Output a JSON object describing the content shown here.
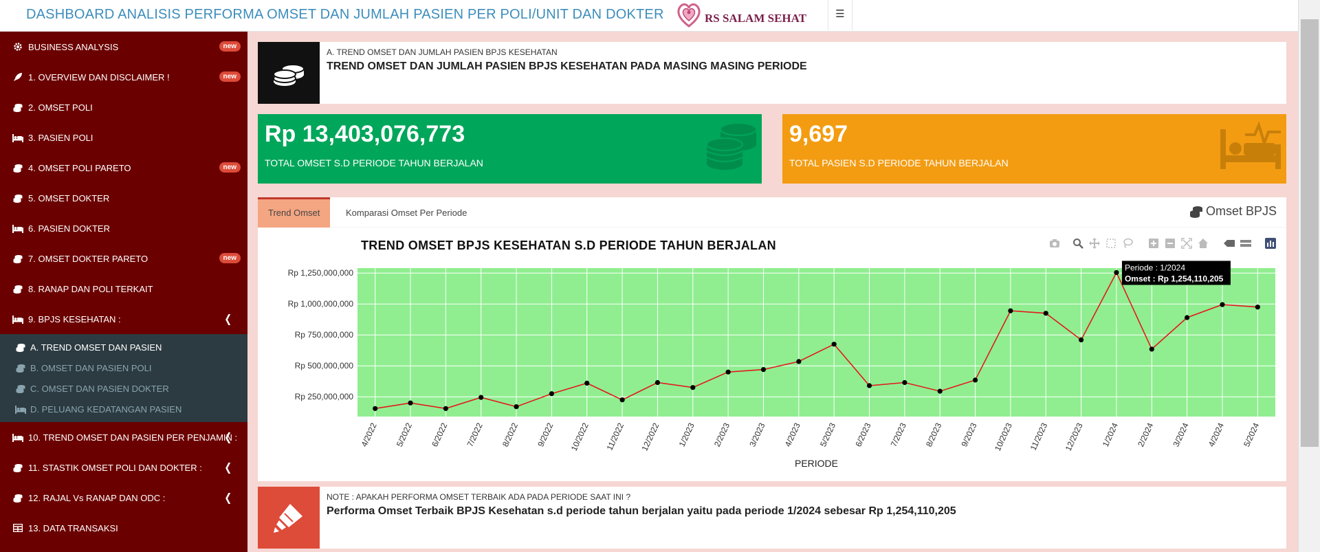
{
  "header": {
    "title": "DASHBOARD ANALISIS PERFORMA OMSET DAN JUMLAH PASIEN PER POLI/UNIT DAN DOKTER",
    "logo_text": "RS SALAM SEHAT",
    "menu_icon": "hamburger-icon"
  },
  "sidebar": {
    "items": [
      {
        "label": "BUSINESS ANALYSIS",
        "icon": "gear-icon",
        "badge": "new"
      },
      {
        "label": "1. OVERVIEW DAN DISCLAIMER !",
        "icon": "rocket-icon",
        "badge": "new"
      },
      {
        "label": "2. OMSET POLI",
        "icon": "coins-icon"
      },
      {
        "label": "3. PASIEN POLI",
        "icon": "bed-icon"
      },
      {
        "label": "4. OMSET POLI PARETO",
        "icon": "coins-icon",
        "badge": "new"
      },
      {
        "label": "5. OMSET DOKTER",
        "icon": "coins-icon"
      },
      {
        "label": "6. PASIEN DOKTER",
        "icon": "bed-icon"
      },
      {
        "label": "7. OMSET DOKTER PARETO",
        "icon": "coins-icon",
        "badge": "new"
      },
      {
        "label": "8. RANAP DAN POLI TERKAIT",
        "icon": "coins-icon"
      },
      {
        "label": "9. BPJS KESEHATAN :",
        "icon": "bed-icon",
        "chevron": "chevron-left-icon"
      }
    ],
    "subitems": [
      {
        "label": "A. TREND OMSET DAN PASIEN",
        "icon": "coins-icon",
        "active": true
      },
      {
        "label": "B. OMSET DAN PASIEN POLI",
        "icon": "coins-icon"
      },
      {
        "label": "C. OMSET DAN PASIEN DOKTER",
        "icon": "coins-icon"
      },
      {
        "label": "D. PELUANG KEDATANGAN PASIEN",
        "icon": "bed-icon"
      }
    ],
    "items_after": [
      {
        "label": "10. TREND OMSET DAN PASIEN PER PENJAMIN :",
        "icon": "bed-icon",
        "chevron": "chevron-left-icon"
      },
      {
        "label": "11. STASTIK OMSET POLI DAN DOKTER :",
        "icon": "coins-icon",
        "chevron": "chevron-left-icon"
      },
      {
        "label": "12. RAJAL Vs RANAP DAN ODC :",
        "icon": "coins-icon",
        "chevron": "chevron-left-icon"
      },
      {
        "label": "13. DATA TRANSAKSI",
        "icon": "table-icon"
      }
    ]
  },
  "topbox": {
    "subtitle": "A. TREND OMSET DAN JUMLAH PASIEN BPJS KESEHATAN",
    "title": "TREND OMSET DAN JUMLAH PASIEN BPJS KESEHATAN PADA MASING MASING PERIODE",
    "icon": "coins-icon"
  },
  "stats": {
    "omset_value": "Rp 13,403,076,773",
    "omset_label": "TOTAL OMSET S.D PERIODE TAHUN BERJALAN",
    "pasien_value": "9,697",
    "pasien_label": "TOTAL PASIEN S.D PERIODE TAHUN BERJALAN",
    "colors": {
      "omset": "#00a65a",
      "pasien": "#f39c12"
    }
  },
  "tabs": {
    "items": [
      "Trend Omset",
      "Komparasi Omset Per Periode"
    ],
    "active": 0,
    "right_label": "Omset BPJS"
  },
  "chart_data": {
    "type": "line",
    "title": "TREND OMSET BPJS KESEHATAN S.D PERIODE TAHUN BERJALAN",
    "xlabel": "PERIODE",
    "ylabel": "",
    "categories": [
      "4/2022",
      "5/2022",
      "6/2022",
      "7/2022",
      "8/2022",
      "9/2022",
      "10/2022",
      "11/2022",
      "12/2022",
      "1/2023",
      "2/2023",
      "3/2023",
      "4/2023",
      "5/2023",
      "6/2023",
      "7/2023",
      "8/2023",
      "9/2023",
      "10/2023",
      "11/2023",
      "12/2023",
      "1/2024",
      "2/2024",
      "3/2024",
      "4/2024",
      "5/2024"
    ],
    "values": [
      155000000,
      200000000,
      155000000,
      245000000,
      170000000,
      275000000,
      360000000,
      225000000,
      365000000,
      325000000,
      450000000,
      470000000,
      535000000,
      675000000,
      340000000,
      365000000,
      295000000,
      385000000,
      945000000,
      925000000,
      710000000,
      1254110205,
      635000000,
      890000000,
      995000000,
      975000000
    ],
    "yticks": [
      "Rp 250,000,000",
      "Rp 500,000,000",
      "Rp 750,000,000",
      "Rp 1,000,000,000",
      "Rp 1,250,000,000"
    ],
    "ytick_values": [
      250000000,
      500000000,
      750000000,
      1000000000,
      1250000000
    ],
    "ylim": [
      90000000,
      1290000000
    ],
    "grid": true,
    "colors": {
      "background": "#90ee90",
      "line": "#e31a1c",
      "marker": "#000000",
      "grid": "#ffffff"
    },
    "tooltip": {
      "index": 21,
      "line1": "Periode : 1/2024",
      "line2": "Omset : Rp 1,254,110,205"
    }
  },
  "note": {
    "subtitle": "NOTE : APAKAH PERFORMA OMSET TERBAIK ADA PADA PERIODE SAAT INI ?",
    "text": "Performa Omset Terbaik BPJS Kesehatan s.d periode tahun berjalan yaitu pada periode 1/2024 sebesar Rp 1,254,110,205",
    "icon": "highlighter-icon",
    "color": "#dd4b39"
  }
}
